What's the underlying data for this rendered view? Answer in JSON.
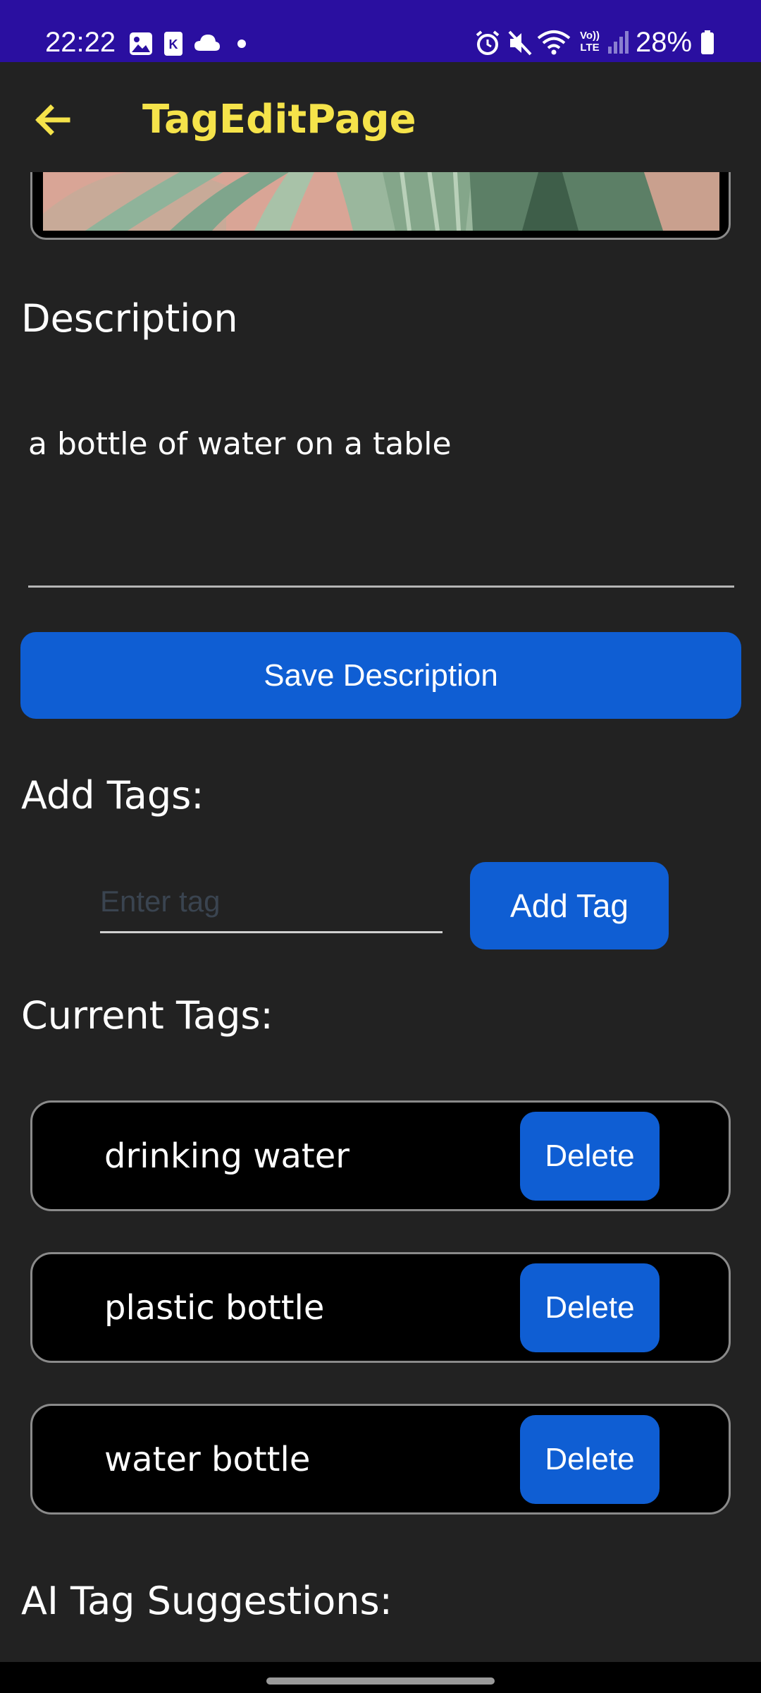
{
  "status_bar": {
    "time": "22:22",
    "battery_percent": "28%",
    "left_icons": [
      "gallery-icon",
      "k-app-icon",
      "cloud-icon",
      "dot-icon"
    ],
    "right_icons": [
      "alarm-icon",
      "mute-icon",
      "wifi-icon",
      "volte-icon",
      "signal-icon",
      "battery-icon"
    ],
    "volte_label": "Vo)) LTE",
    "background_color": "#2a0fa0"
  },
  "app_bar": {
    "title": "TagEditPage",
    "title_color": "#f5e34a",
    "back_icon": "arrow-left-icon"
  },
  "description_section": {
    "heading": "Description",
    "value": "a bottle of water on a table",
    "save_label": "Save Description"
  },
  "add_tags_section": {
    "heading": "Add Tags:",
    "placeholder": "Enter tag",
    "add_label": "Add Tag"
  },
  "current_tags_section": {
    "heading": "Current Tags:",
    "tags": [
      {
        "label": "drinking water",
        "delete_label": "Delete"
      },
      {
        "label": "plastic bottle",
        "delete_label": "Delete"
      },
      {
        "label": "water bottle",
        "delete_label": "Delete"
      }
    ]
  },
  "ai_section": {
    "heading": "AI Tag Suggestions:"
  },
  "colors": {
    "background": "#222222",
    "accent_button": "#0f5ed3",
    "card_background": "#000000",
    "card_border": "#8a8a8a"
  }
}
